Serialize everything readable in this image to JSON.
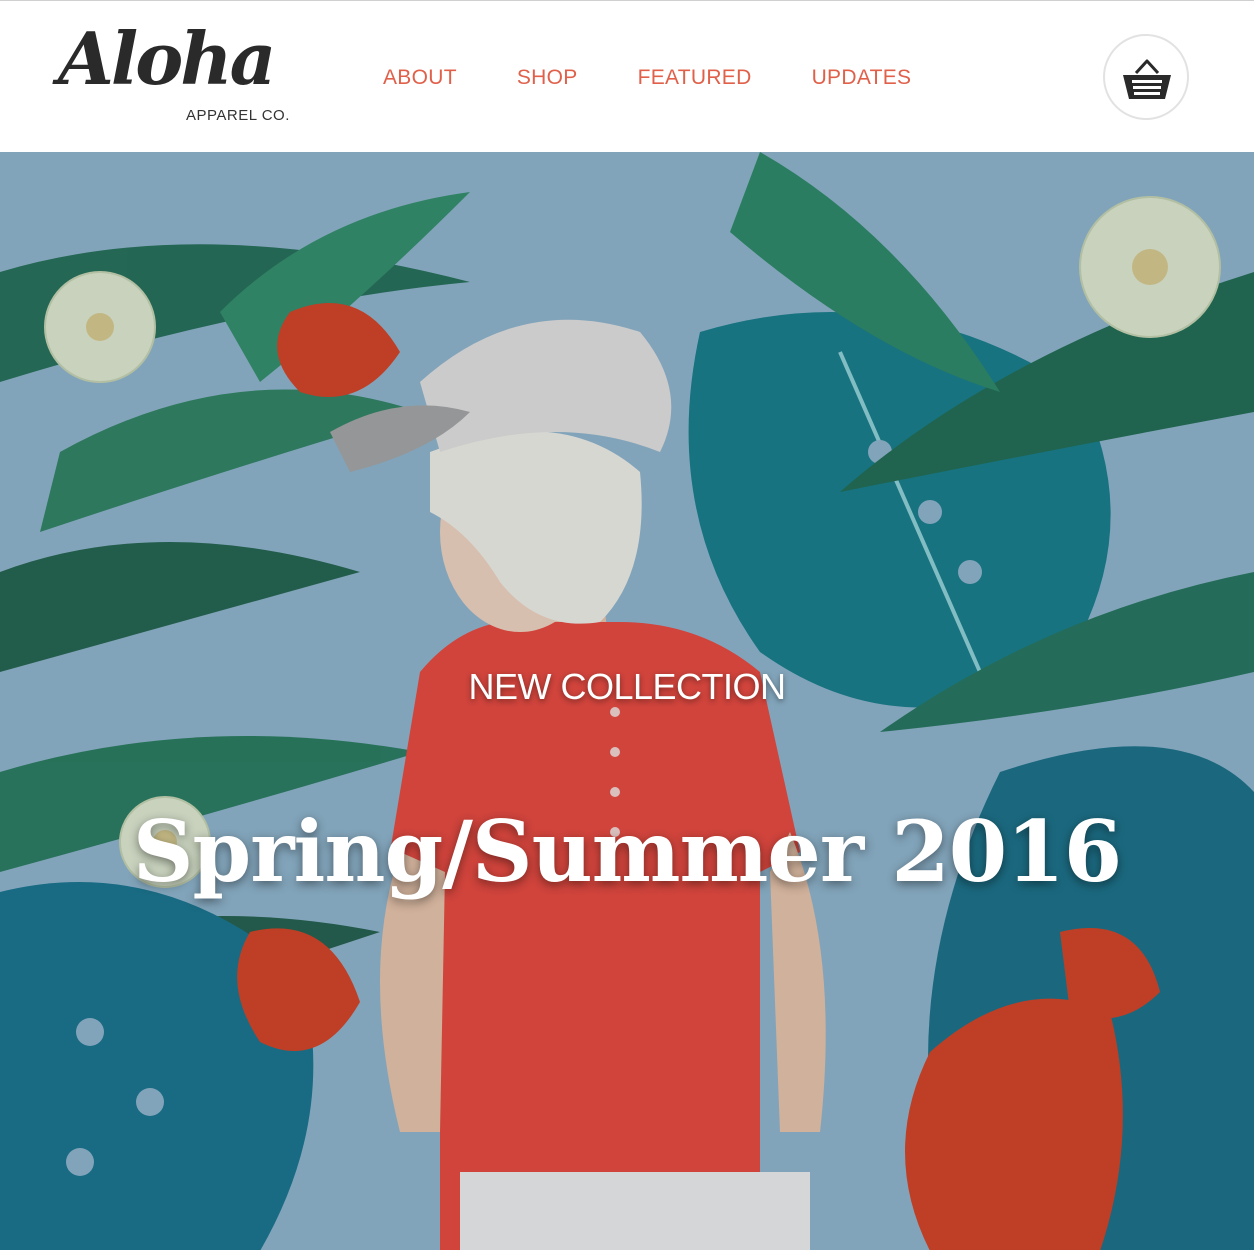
{
  "brand": {
    "logo_script": "Aloha",
    "logo_sub": "APPAREL CO."
  },
  "nav": {
    "items": [
      {
        "label": "ABOUT"
      },
      {
        "label": "SHOP"
      },
      {
        "label": "FEATURED"
      },
      {
        "label": "UPDATES"
      }
    ],
    "color": "#e0604a"
  },
  "cart": {
    "icon": "basket-icon"
  },
  "hero": {
    "eyebrow": "NEW COLLECTION",
    "headline": "Spring/Summer 2016",
    "background_color": "#8fb3c9",
    "shirt_color": "#e8463a"
  }
}
